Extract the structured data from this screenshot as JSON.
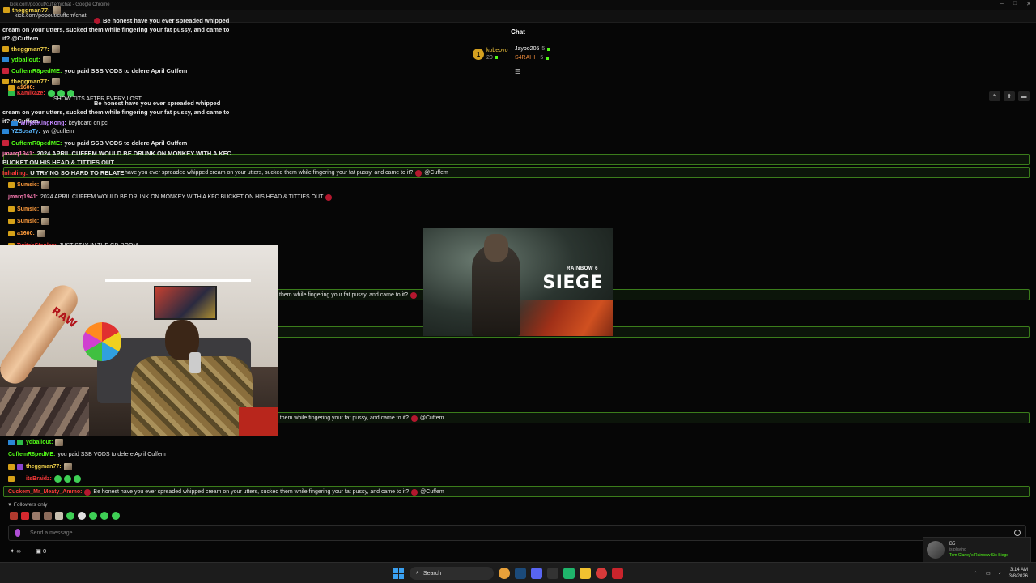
{
  "window": {
    "title": "kick.com/popout/cuffem/chat - Google Chrome",
    "controls": [
      "–",
      "□",
      "✕"
    ]
  },
  "browser": {
    "url": "kick.com/popout/cuffem/chat"
  },
  "chat": {
    "header": "Chat",
    "gifters": [
      {
        "rank": "1",
        "name": "kobeovo",
        "count": "20"
      },
      {
        "name": "Jaybo205",
        "count": "5"
      },
      {
        "name": "S4RAHH",
        "count": "5"
      }
    ]
  },
  "messages": [
    {
      "user": "theggman77:",
      "text": "",
      "color": "u-yellow"
    },
    {
      "user": "",
      "text": "Be honest have you ever spreaded whipped",
      "color": "u-red"
    },
    {
      "user": "",
      "text": "cream on your utters, sucked them while fingering your fat pussy, and came to",
      "color": ""
    },
    {
      "user": "",
      "text": "it? @Cuffem",
      "color": ""
    },
    {
      "user": "theggman77:",
      "text": "",
      "color": "u-yellow"
    },
    {
      "user": "ydballout:",
      "text": "",
      "color": "u-green"
    },
    {
      "user": "CuffemR8pedME:",
      "text": "you paid SSB VODS to delere April Cuffem",
      "color": "u-green"
    },
    {
      "user": "theggman77:",
      "text": "",
      "color": "u-yellow"
    },
    {
      "user": "a1600:",
      "text": "",
      "color": "u-orange"
    },
    {
      "user": "Kamikaze:",
      "text": "",
      "color": "u-red"
    },
    {
      "user": "",
      "text": "SHOW TITS AFTER EVERY LOST",
      "color": ""
    },
    {
      "user": "",
      "text": "Be honest have you ever spreaded whipped",
      "color": ""
    },
    {
      "user": "",
      "text": "cream on your utters, sucked them while fingering your fat pussy, and came to",
      "color": ""
    },
    {
      "user": "",
      "text": "it? @Cuffem",
      "color": ""
    },
    {
      "user": "WhyteKingKong:",
      "text": "keyboard on pc",
      "color": "u-purple"
    },
    {
      "user": "YZSosaTy:",
      "text": "yw @cuffem",
      "color": "u-blue"
    },
    {
      "user": "CuffemR8pedME:",
      "text": "you paid SSB VODS to delere April Cuffem",
      "color": "u-green"
    },
    {
      "user": "jmarq1941:",
      "text": "2024 APRIL CUFFEM WOULD BE DRUNK ON MONKEY WITH A KFC",
      "color": "u-pink"
    },
    {
      "user": "",
      "text": "BUCKET ON HIS HEAD & TITTIES OUT",
      "color": ""
    },
    {
      "user": "Inhaling:",
      "text": "U TRYING SO HARD TO RELATE",
      "color": "u-red"
    }
  ],
  "highlights": [
    {
      "text": "have you ever spreaded whipped cream on your utters, sucked them while fingering your fat pussy, and came to it?",
      "mention": "@Cuffem"
    },
    {
      "text": "them while fingering your fat pussy, and came to it?",
      "mention": ""
    },
    {
      "text": "d them while fingering your fat pussy, and came to it?",
      "mention": "@Cuffem"
    },
    {
      "user": "Cuckem_Mr_Meaty_Ammo:",
      "text": "Be honest have you ever spreaded whipped cream on your utters, sucked them while fingering your fat pussy, and came to it?",
      "mention": "@Cuffem"
    }
  ],
  "lower_messages": [
    {
      "user": "Sumsic:",
      "text": ""
    },
    {
      "user": "jmarq1941:",
      "text": "2024 APRIL CUFFEM WOULD BE DRUNK ON MONKEY WITH A KFC BUCKET ON HIS HEAD & TITTIES OUT"
    },
    {
      "user": "Sumsic:",
      "text": ""
    },
    {
      "user": "Sumsic:",
      "text": ""
    },
    {
      "user": "a1600:",
      "text": ""
    },
    {
      "user": "TwitchStanley:",
      "text": "JUST STAY IN THE GD ROOM"
    },
    {
      "user": "ydballout:",
      "text": ""
    },
    {
      "user": "CuffemR8pedME:",
      "text": "you paid SSB VODS to delere April Cuffem"
    },
    {
      "user": "theggman77:",
      "text": ""
    },
    {
      "user": "itsBraidz:",
      "text": ""
    }
  ],
  "game": {
    "brand": "RAINBOW 6",
    "title": "SIEGE"
  },
  "webcam": {
    "bat_text": "RAW"
  },
  "footer": {
    "followers_only": "Followers only",
    "input_placeholder": "Send a message",
    "infinite": "∞",
    "count": "0"
  },
  "toast": {
    "name": "B5",
    "status": "is playing",
    "game": "Tom Clancy's Rainbow Six Siege"
  },
  "taskbar": {
    "search": "Search",
    "time": "3:14 AM",
    "date": "3/8/2026"
  }
}
